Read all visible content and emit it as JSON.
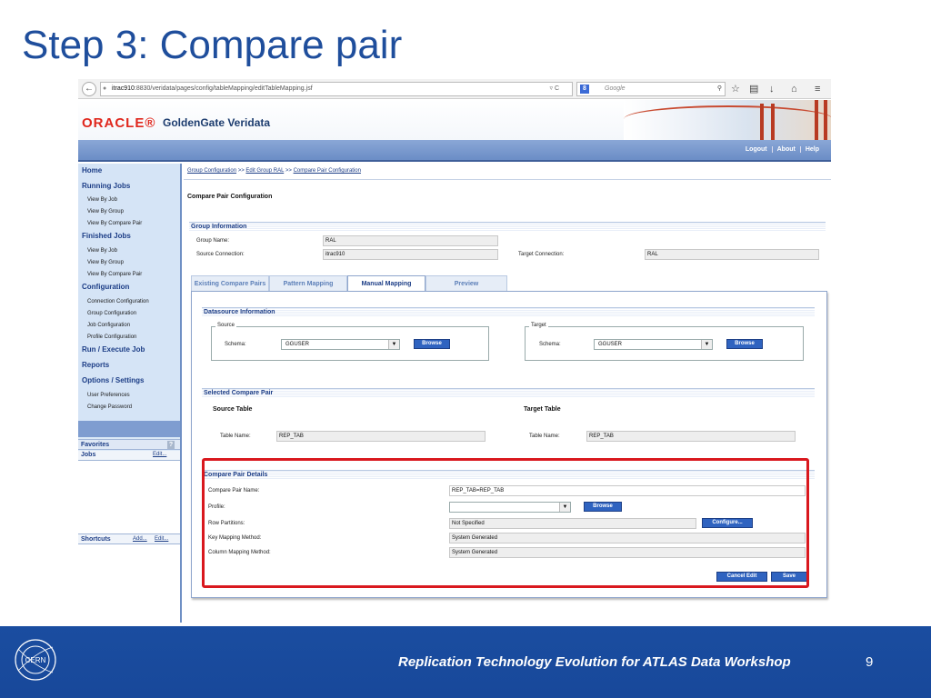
{
  "slide": {
    "title": "Step 3: Compare pair"
  },
  "browser": {
    "url_host": "itrac910",
    "url_path": ":8830/veridata/pages/config/tableMapping/editTableMapping.jsf",
    "search_badge": "8",
    "search_placeholder": "Google"
  },
  "app": {
    "vendor": "ORACLE®",
    "product": "GoldenGate Veridata",
    "top_links": [
      "Logout",
      "About",
      "Help"
    ]
  },
  "sidebar": {
    "home": "Home",
    "running_jobs": {
      "label": "Running Jobs",
      "items": [
        "View By Job",
        "View By Group",
        "View By Compare Pair"
      ]
    },
    "finished_jobs": {
      "label": "Finished Jobs",
      "items": [
        "View By Job",
        "View By Group",
        "View By Compare Pair"
      ]
    },
    "configuration": {
      "label": "Configuration",
      "items": [
        "Connection Configuration",
        "Group Configuration",
        "Job Configuration",
        "Profile Configuration"
      ]
    },
    "run_execute": "Run / Execute Job",
    "reports": "Reports",
    "options": {
      "label": "Options / Settings",
      "items": [
        "User Preferences",
        "Change Password"
      ]
    },
    "favorites": {
      "label": "Favorites",
      "jobs": "Jobs",
      "edit": "Edit..."
    },
    "shortcuts": {
      "label": "Shortcuts",
      "add": "Add...",
      "edit": "Edit..."
    }
  },
  "breadcrumb": [
    "Group Configuration",
    "Edit Group RAL",
    "Compare Pair Configuration"
  ],
  "breadcrumb_sep": ">>",
  "page": {
    "title": "Compare Pair Configuration"
  },
  "group_info": {
    "header": "Group Information",
    "group_name_label": "Group Name:",
    "group_name": "RAL",
    "source_conn_label": "Source Connection:",
    "source_conn": "itrac910",
    "target_conn_label": "Target Connection:",
    "target_conn": "RAL"
  },
  "tabs": [
    "Existing Compare Pairs",
    "Pattern Mapping",
    "Manual Mapping",
    "Preview"
  ],
  "datasource": {
    "header": "Datasource Information",
    "source_legend": "Source",
    "target_legend": "Target",
    "schema_label": "Schema:",
    "source_schema": "GGUSER",
    "target_schema": "GGUSER",
    "browse": "Browse"
  },
  "selected_pair": {
    "header": "Selected Compare Pair",
    "source_heading": "Source Table",
    "target_heading": "Target Table",
    "table_name_label": "Table Name:",
    "source_table": "REP_TAB",
    "target_table": "REP_TAB"
  },
  "details": {
    "header": "Compare Pair Details",
    "pair_name_label": "Compare Pair Name:",
    "pair_name": "REP_TAB=REP_TAB",
    "profile_label": "Profile:",
    "profile_value": "",
    "browse": "Browse",
    "row_partitions_label": "Row Partitions:",
    "row_partitions": "Not Specified",
    "configure": "Configure...",
    "key_mapping_label": "Key Mapping Method:",
    "key_mapping": "System Generated",
    "column_mapping_label": "Column Mapping Method:",
    "column_mapping": "System Generated",
    "cancel_edit": "Cancel Edit",
    "save": "Save"
  },
  "footer": {
    "logo_text": "CERN",
    "text": "Replication Technology Evolution for ATLAS Data Workshop",
    "page": "9"
  },
  "colors": {
    "title": "#1f4e9c",
    "footer_bg": "#1a4da0",
    "highlight": "#d9181e",
    "button": "#2f63c0",
    "oracle_red": "#e0271d"
  }
}
